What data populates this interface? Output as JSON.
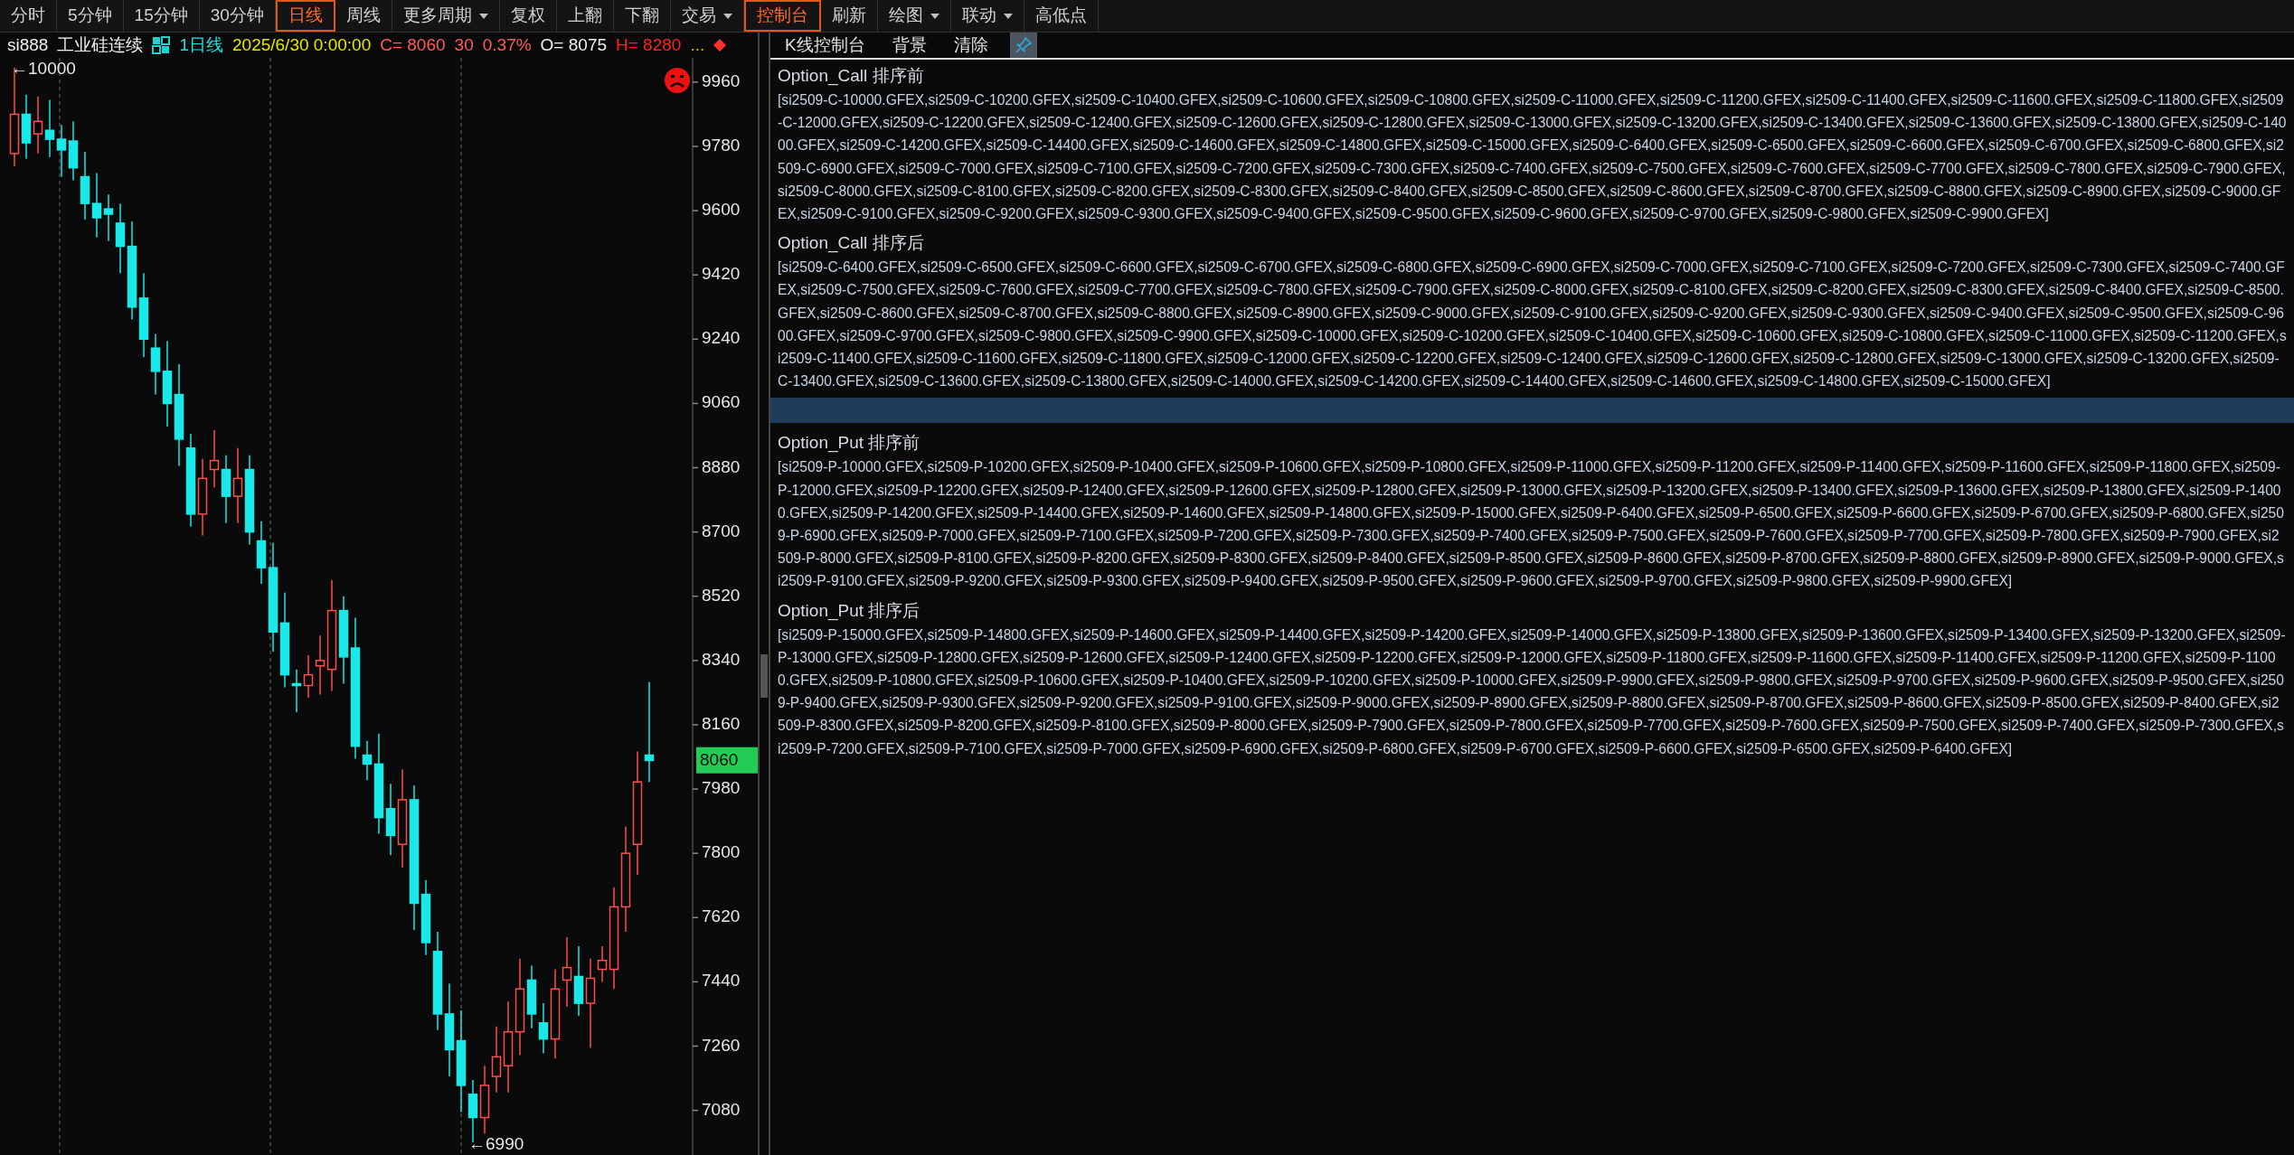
{
  "toolbar": [
    {
      "label": "分时",
      "selected": false,
      "dropdown": false
    },
    {
      "label": "5分钟",
      "selected": false,
      "dropdown": false
    },
    {
      "label": "15分钟",
      "selected": false,
      "dropdown": false
    },
    {
      "label": "30分钟",
      "selected": false,
      "dropdown": false
    },
    {
      "label": "日线",
      "selected": true,
      "dropdown": false
    },
    {
      "label": "周线",
      "selected": false,
      "dropdown": false
    },
    {
      "label": "更多周期",
      "selected": false,
      "dropdown": true
    },
    {
      "label": "复权",
      "selected": false,
      "dropdown": false
    },
    {
      "label": "上翻",
      "selected": false,
      "dropdown": false
    },
    {
      "label": "下翻",
      "selected": false,
      "dropdown": false
    },
    {
      "label": "交易",
      "selected": false,
      "dropdown": true
    },
    {
      "label": "控制台",
      "selected": true,
      "dropdown": false
    },
    {
      "label": "刷新",
      "selected": false,
      "dropdown": false
    },
    {
      "label": "绘图",
      "selected": false,
      "dropdown": true
    },
    {
      "label": "联动",
      "selected": false,
      "dropdown": true
    },
    {
      "label": "高低点",
      "selected": false,
      "dropdown": false
    }
  ],
  "chart_header": {
    "symbol": "si888",
    "name": "工业硅连续",
    "period": "1日线",
    "datetime": "2025/6/30 0:00:00",
    "close": "C= 8060",
    "change": "30",
    "change_pct": "0.37%",
    "open": "O= 8075",
    "high": "H= 8280",
    "more": "..."
  },
  "chart": {
    "high_marker": "←10000",
    "low_marker": "←6990",
    "last_price": "8060",
    "chart_data": {
      "type": "candlestick",
      "ylim": [
        6955,
        10028
      ],
      "yticks": [
        9960,
        9780,
        9600,
        9420,
        9240,
        9060,
        8880,
        8700,
        8520,
        8340,
        8160,
        7980,
        7800,
        7620,
        7440,
        7260,
        7080
      ],
      "ohlc": [
        [
          9760,
          10000,
          9725,
          9870
        ],
        [
          9870,
          9925,
          9745,
          9790
        ],
        [
          9815,
          9920,
          9760,
          9850
        ],
        [
          9825,
          9910,
          9750,
          9800
        ],
        [
          9800,
          9840,
          9695,
          9770
        ],
        [
          9795,
          9850,
          9685,
          9720
        ],
        [
          9695,
          9765,
          9575,
          9620
        ],
        [
          9620,
          9705,
          9525,
          9580
        ],
        [
          9605,
          9645,
          9515,
          9590
        ],
        [
          9565,
          9620,
          9425,
          9500
        ],
        [
          9500,
          9570,
          9295,
          9330
        ],
        [
          9355,
          9425,
          9190,
          9240
        ],
        [
          9215,
          9255,
          9085,
          9150
        ],
        [
          9150,
          9235,
          8995,
          9060
        ],
        [
          9085,
          9170,
          8885,
          8960
        ],
        [
          8935,
          8975,
          8715,
          8750
        ],
        [
          8750,
          8905,
          8690,
          8850
        ],
        [
          8875,
          8985,
          8825,
          8900
        ],
        [
          8875,
          8915,
          8725,
          8800
        ],
        [
          8800,
          8935,
          8725,
          8850
        ],
        [
          8875,
          8915,
          8665,
          8700
        ],
        [
          8675,
          8730,
          8555,
          8600
        ],
        [
          8600,
          8670,
          8365,
          8420
        ],
        [
          8445,
          8530,
          8265,
          8300
        ],
        [
          8275,
          8315,
          8195,
          8270
        ],
        [
          8270,
          8355,
          8235,
          8300
        ],
        [
          8325,
          8410,
          8245,
          8340
        ],
        [
          8315,
          8565,
          8255,
          8480
        ],
        [
          8480,
          8520,
          8275,
          8350
        ],
        [
          8375,
          8460,
          8065,
          8100
        ],
        [
          8075,
          8115,
          8005,
          8050
        ],
        [
          8050,
          8135,
          7855,
          7900
        ],
        [
          7925,
          7995,
          7795,
          7850
        ],
        [
          7825,
          8035,
          7760,
          7950
        ],
        [
          7950,
          7990,
          7585,
          7660
        ],
        [
          7685,
          7725,
          7515,
          7550
        ],
        [
          7525,
          7580,
          7305,
          7350
        ],
        [
          7350,
          7435,
          7175,
          7250
        ],
        [
          7275,
          7360,
          7075,
          7150
        ],
        [
          7125,
          7165,
          6990,
          7060
        ],
        [
          7060,
          7205,
          7015,
          7150
        ],
        [
          7175,
          7315,
          7130,
          7230
        ],
        [
          7205,
          7385,
          7130,
          7300
        ],
        [
          7300,
          7505,
          7235,
          7420
        ],
        [
          7445,
          7485,
          7310,
          7350
        ],
        [
          7325,
          7380,
          7240,
          7280
        ],
        [
          7280,
          7475,
          7225,
          7420
        ],
        [
          7445,
          7565,
          7370,
          7480
        ],
        [
          7455,
          7540,
          7345,
          7380
        ],
        [
          7380,
          7505,
          7255,
          7450
        ],
        [
          7475,
          7540,
          7440,
          7500
        ],
        [
          7475,
          7705,
          7420,
          7650
        ],
        [
          7650,
          7875,
          7580,
          7800
        ],
        [
          7825,
          8085,
          7740,
          8000
        ],
        [
          8075,
          8280,
          8000,
          8060
        ]
      ]
    }
  },
  "console": {
    "buttons": [
      "K线控制台",
      "背景",
      "清除"
    ],
    "sections": [
      {
        "kind": "log",
        "title": "Option_Call 排序前",
        "content": "[si2509-C-10000.GFEX,si2509-C-10200.GFEX,si2509-C-10400.GFEX,si2509-C-10600.GFEX,si2509-C-10800.GFEX,si2509-C-11000.GFEX,si2509-C-11200.GFEX,si2509-C-11400.GFEX,si2509-C-11600.GFEX,si2509-C-11800.GFEX,si2509-C-12000.GFEX,si2509-C-12200.GFEX,si2509-C-12400.GFEX,si2509-C-12600.GFEX,si2509-C-12800.GFEX,si2509-C-13000.GFEX,si2509-C-13200.GFEX,si2509-C-13400.GFEX,si2509-C-13600.GFEX,si2509-C-13800.GFEX,si2509-C-14000.GFEX,si2509-C-14200.GFEX,si2509-C-14400.GFEX,si2509-C-14600.GFEX,si2509-C-14800.GFEX,si2509-C-15000.GFEX,si2509-C-6400.GFEX,si2509-C-6500.GFEX,si2509-C-6600.GFEX,si2509-C-6700.GFEX,si2509-C-6800.GFEX,si2509-C-6900.GFEX,si2509-C-7000.GFEX,si2509-C-7100.GFEX,si2509-C-7200.GFEX,si2509-C-7300.GFEX,si2509-C-7400.GFEX,si2509-C-7500.GFEX,si2509-C-7600.GFEX,si2509-C-7700.GFEX,si2509-C-7800.GFEX,si2509-C-7900.GFEX,si2509-C-8000.GFEX,si2509-C-8100.GFEX,si2509-C-8200.GFEX,si2509-C-8300.GFEX,si2509-C-8400.GFEX,si2509-C-8500.GFEX,si2509-C-8600.GFEX,si2509-C-8700.GFEX,si2509-C-8800.GFEX,si2509-C-8900.GFEX,si2509-C-9000.GFEX,si2509-C-9100.GFEX,si2509-C-9200.GFEX,si2509-C-9300.GFEX,si2509-C-9400.GFEX,si2509-C-9500.GFEX,si2509-C-9600.GFEX,si2509-C-9700.GFEX,si2509-C-9800.GFEX,si2509-C-9900.GFEX]"
      },
      {
        "kind": "log",
        "title": "Option_Call 排序后",
        "content": "[si2509-C-6400.GFEX,si2509-C-6500.GFEX,si2509-C-6600.GFEX,si2509-C-6700.GFEX,si2509-C-6800.GFEX,si2509-C-6900.GFEX,si2509-C-7000.GFEX,si2509-C-7100.GFEX,si2509-C-7200.GFEX,si2509-C-7300.GFEX,si2509-C-7400.GFEX,si2509-C-7500.GFEX,si2509-C-7600.GFEX,si2509-C-7700.GFEX,si2509-C-7800.GFEX,si2509-C-7900.GFEX,si2509-C-8000.GFEX,si2509-C-8100.GFEX,si2509-C-8200.GFEX,si2509-C-8300.GFEX,si2509-C-8400.GFEX,si2509-C-8500.GFEX,si2509-C-8600.GFEX,si2509-C-8700.GFEX,si2509-C-8800.GFEX,si2509-C-8900.GFEX,si2509-C-9000.GFEX,si2509-C-9100.GFEX,si2509-C-9200.GFEX,si2509-C-9300.GFEX,si2509-C-9400.GFEX,si2509-C-9500.GFEX,si2509-C-9600.GFEX,si2509-C-9700.GFEX,si2509-C-9800.GFEX,si2509-C-9900.GFEX,si2509-C-10000.GFEX,si2509-C-10200.GFEX,si2509-C-10400.GFEX,si2509-C-10600.GFEX,si2509-C-10800.GFEX,si2509-C-11000.GFEX,si2509-C-11200.GFEX,si2509-C-11400.GFEX,si2509-C-11600.GFEX,si2509-C-11800.GFEX,si2509-C-12000.GFEX,si2509-C-12200.GFEX,si2509-C-12400.GFEX,si2509-C-12600.GFEX,si2509-C-12800.GFEX,si2509-C-13000.GFEX,si2509-C-13200.GFEX,si2509-C-13400.GFEX,si2509-C-13600.GFEX,si2509-C-13800.GFEX,si2509-C-14000.GFEX,si2509-C-14200.GFEX,si2509-C-14400.GFEX,si2509-C-14600.GFEX,si2509-C-14800.GFEX,si2509-C-15000.GFEX]"
      },
      {
        "kind": "divider",
        "selected": true
      },
      {
        "kind": "log",
        "title": "Option_Put 排序前",
        "content": "[si2509-P-10000.GFEX,si2509-P-10200.GFEX,si2509-P-10400.GFEX,si2509-P-10600.GFEX,si2509-P-10800.GFEX,si2509-P-11000.GFEX,si2509-P-11200.GFEX,si2509-P-11400.GFEX,si2509-P-11600.GFEX,si2509-P-11800.GFEX,si2509-P-12000.GFEX,si2509-P-12200.GFEX,si2509-P-12400.GFEX,si2509-P-12600.GFEX,si2509-P-12800.GFEX,si2509-P-13000.GFEX,si2509-P-13200.GFEX,si2509-P-13400.GFEX,si2509-P-13600.GFEX,si2509-P-13800.GFEX,si2509-P-14000.GFEX,si2509-P-14200.GFEX,si2509-P-14400.GFEX,si2509-P-14600.GFEX,si2509-P-14800.GFEX,si2509-P-15000.GFEX,si2509-P-6400.GFEX,si2509-P-6500.GFEX,si2509-P-6600.GFEX,si2509-P-6700.GFEX,si2509-P-6800.GFEX,si2509-P-6900.GFEX,si2509-P-7000.GFEX,si2509-P-7100.GFEX,si2509-P-7200.GFEX,si2509-P-7300.GFEX,si2509-P-7400.GFEX,si2509-P-7500.GFEX,si2509-P-7600.GFEX,si2509-P-7700.GFEX,si2509-P-7800.GFEX,si2509-P-7900.GFEX,si2509-P-8000.GFEX,si2509-P-8100.GFEX,si2509-P-8200.GFEX,si2509-P-8300.GFEX,si2509-P-8400.GFEX,si2509-P-8500.GFEX,si2509-P-8600.GFEX,si2509-P-8700.GFEX,si2509-P-8800.GFEX,si2509-P-8900.GFEX,si2509-P-9000.GFEX,si2509-P-9100.GFEX,si2509-P-9200.GFEX,si2509-P-9300.GFEX,si2509-P-9400.GFEX,si2509-P-9500.GFEX,si2509-P-9600.GFEX,si2509-P-9700.GFEX,si2509-P-9800.GFEX,si2509-P-9900.GFEX]"
      },
      {
        "kind": "log",
        "title": "Option_Put 排序后",
        "content": "[si2509-P-15000.GFEX,si2509-P-14800.GFEX,si2509-P-14600.GFEX,si2509-P-14400.GFEX,si2509-P-14200.GFEX,si2509-P-14000.GFEX,si2509-P-13800.GFEX,si2509-P-13600.GFEX,si2509-P-13400.GFEX,si2509-P-13200.GFEX,si2509-P-13000.GFEX,si2509-P-12800.GFEX,si2509-P-12600.GFEX,si2509-P-12400.GFEX,si2509-P-12200.GFEX,si2509-P-12000.GFEX,si2509-P-11800.GFEX,si2509-P-11600.GFEX,si2509-P-11400.GFEX,si2509-P-11200.GFEX,si2509-P-11000.GFEX,si2509-P-10800.GFEX,si2509-P-10600.GFEX,si2509-P-10400.GFEX,si2509-P-10200.GFEX,si2509-P-10000.GFEX,si2509-P-9900.GFEX,si2509-P-9800.GFEX,si2509-P-9700.GFEX,si2509-P-9600.GFEX,si2509-P-9500.GFEX,si2509-P-9400.GFEX,si2509-P-9300.GFEX,si2509-P-9200.GFEX,si2509-P-9100.GFEX,si2509-P-9000.GFEX,si2509-P-8900.GFEX,si2509-P-8800.GFEX,si2509-P-8700.GFEX,si2509-P-8600.GFEX,si2509-P-8500.GFEX,si2509-P-8400.GFEX,si2509-P-8300.GFEX,si2509-P-8200.GFEX,si2509-P-8100.GFEX,si2509-P-8000.GFEX,si2509-P-7900.GFEX,si2509-P-7800.GFEX,si2509-P-7700.GFEX,si2509-P-7600.GFEX,si2509-P-7500.GFEX,si2509-P-7400.GFEX,si2509-P-7300.GFEX,si2509-P-7200.GFEX,si2509-P-7100.GFEX,si2509-P-7000.GFEX,si2509-P-6900.GFEX,si2509-P-6800.GFEX,si2509-P-6700.GFEX,si2509-P-6600.GFEX,si2509-P-6500.GFEX,si2509-P-6400.GFEX]"
      }
    ]
  }
}
